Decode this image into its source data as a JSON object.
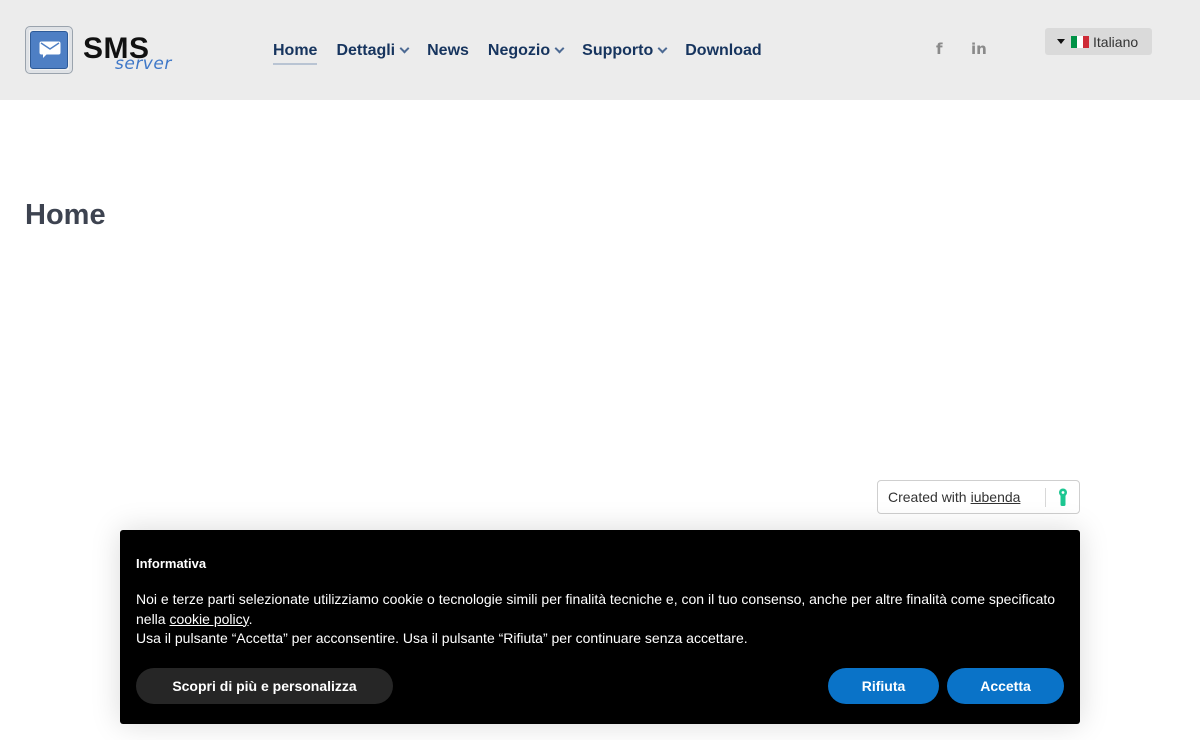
{
  "logo": {
    "brand": "SMS",
    "sub": "server"
  },
  "nav": {
    "items": [
      {
        "label": "Home",
        "active": true,
        "dropdown": false
      },
      {
        "label": "Dettagli",
        "active": false,
        "dropdown": true
      },
      {
        "label": "News",
        "active": false,
        "dropdown": false
      },
      {
        "label": "Negozio",
        "active": false,
        "dropdown": true
      },
      {
        "label": "Supporto",
        "active": false,
        "dropdown": true
      },
      {
        "label": "Download",
        "active": false,
        "dropdown": false
      }
    ]
  },
  "social": {
    "facebook": "f",
    "linkedin": "in"
  },
  "language": {
    "selected": "Italiano",
    "flag_colors": [
      "#009246",
      "#ffffff",
      "#ce2b37"
    ]
  },
  "main": {
    "title": "Home"
  },
  "iubenda": {
    "prefix": "Created with",
    "link": "iubenda",
    "icon_color": "#1cc691"
  },
  "cookie": {
    "title": "Informativa",
    "text_1": "Noi e terze parti selezionate utilizziamo cookie o tecnologie simili per finalità tecniche e, con il tuo consenso, anche per altre finalità come specificato nella",
    "policy_link": "cookie policy",
    "text_1_end": ".",
    "text_2": "Usa il pulsante “Accetta” per acconsentire. Usa il pulsante “Rifiuta” per continuare senza accettare.",
    "btn_more": "Scopri di più e personalizza",
    "btn_reject": "Rifiuta",
    "btn_accept": "Accetta",
    "accent": "#0a73c8"
  },
  "colors": {
    "header_bg": "#ececec",
    "nav_text": "#16345e",
    "banner_bg": "#000000"
  }
}
